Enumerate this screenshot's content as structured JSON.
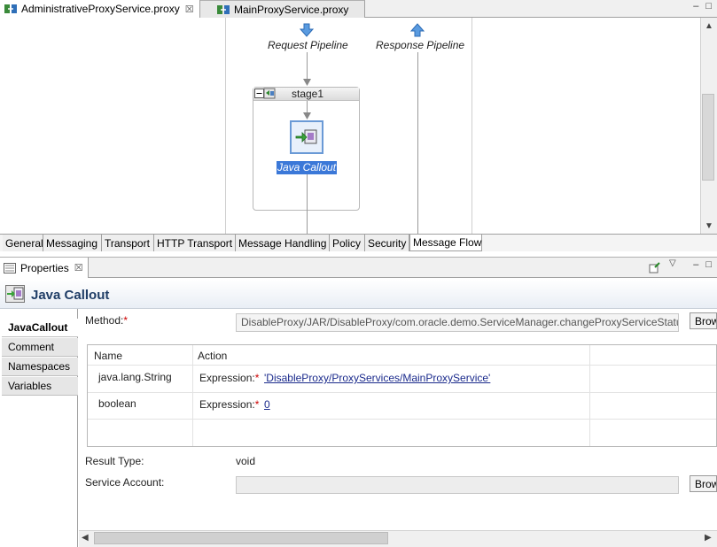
{
  "editor_tabs": [
    {
      "label": "AdministrativeProxyService.proxy",
      "close": "☒"
    },
    {
      "label": "MainProxyService.proxy"
    }
  ],
  "window_controls": {
    "minimize": "–",
    "maximize": "□"
  },
  "canvas": {
    "request_pipeline": "Request Pipeline",
    "response_pipeline": "Response Pipeline",
    "stage_label": "stage1",
    "node_label": "Java Callout"
  },
  "page_tabs": [
    "General",
    "Messaging",
    "Transport",
    "HTTP Transport",
    "Message Handling",
    "Policy",
    "Security",
    "Message Flow"
  ],
  "properties": {
    "view_title": "Properties",
    "close": "☒",
    "header_title": "Java Callout",
    "side_items": [
      "JavaCallout",
      "Comment",
      "Namespaces",
      "Variables"
    ],
    "method_label": "Method:",
    "required_mark": "*",
    "method_value": "DisableProxy/JAR/DisableProxy/com.oracle.demo.ServiceManager.changeProxyServiceStatus",
    "browse_label": "Brow",
    "table": {
      "headers": [
        "Name",
        "Action"
      ],
      "rows": [
        {
          "name": "java.lang.String",
          "action_label": "Expression:",
          "value": "'DisableProxy/ProxyServices/MainProxyService'"
        },
        {
          "name": "boolean",
          "action_label": "Expression:",
          "value": "0"
        }
      ]
    },
    "result_type_label": "Result Type:",
    "result_type_value": "void",
    "service_account_label": "Service Account:",
    "service_account_value": "",
    "service_browse_label": "Brow"
  },
  "colors": {
    "selection": "#3b78d8",
    "header_title": "#1f3d66",
    "link": "#1a2a8c",
    "required": "#cc0000"
  }
}
